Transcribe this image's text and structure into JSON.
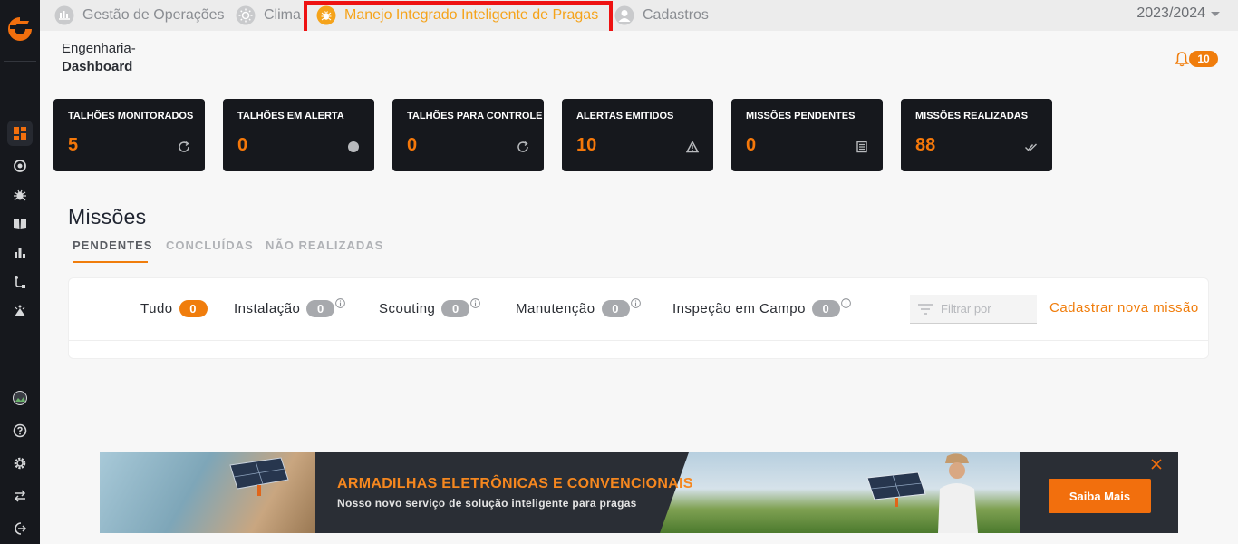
{
  "nav": {
    "items": [
      {
        "label": "Gestão de Operações",
        "icon": "chart-hand-icon"
      },
      {
        "label": "Clima",
        "icon": "sun-icon"
      },
      {
        "label": "Manejo Integrado Inteligente de Pragas",
        "icon": "bug-icon"
      },
      {
        "label": "Cadastros",
        "icon": "user-icon"
      }
    ],
    "season": "2023/2024"
  },
  "header": {
    "breadcrumb_top": "Engenharia-",
    "breadcrumb_bottom": "Dashboard",
    "notification_count": "10"
  },
  "cards": [
    {
      "title": "TALHÕES MONITORADOS",
      "value": "5",
      "icon": "refresh-icon"
    },
    {
      "title": "TALHÕES EM ALERTA",
      "value": "0",
      "icon": "dot-icon"
    },
    {
      "title": "TALHÕES PARA CONTROLE",
      "value": "0",
      "icon": "refresh-icon"
    },
    {
      "title": "ALERTAS EMITIDOS",
      "value": "10",
      "icon": "warning-icon"
    },
    {
      "title": "MISSÕES PENDENTES",
      "value": "0",
      "icon": "list-icon"
    },
    {
      "title": "MISSÕES REALIZADAS",
      "value": "88",
      "icon": "double-check-icon"
    }
  ],
  "missions": {
    "title": "Missões",
    "tabs": [
      "PENDENTES",
      "CONCLUÍDAS",
      "NÃO REALIZADAS"
    ],
    "filters": [
      {
        "label": "Tudo",
        "count": "0"
      },
      {
        "label": "Instalação",
        "count": "0"
      },
      {
        "label": "Scouting",
        "count": "0"
      },
      {
        "label": "Manutenção",
        "count": "0"
      },
      {
        "label": "Inspeção em Campo",
        "count": "0"
      }
    ],
    "filter_placeholder": "Filtrar por",
    "new_mission_label": "Cadastrar nova missão"
  },
  "banner": {
    "title": "ARMADILHAS ELETRÔNICAS E CONVENCIONAIS",
    "subtitle": "Nosso novo serviço de solução inteligente para pragas",
    "button_label": "Saiba Mais"
  },
  "colors": {
    "accent": "#f07d0c",
    "sidebar": "#16181d",
    "highlight": "#ee1111"
  }
}
